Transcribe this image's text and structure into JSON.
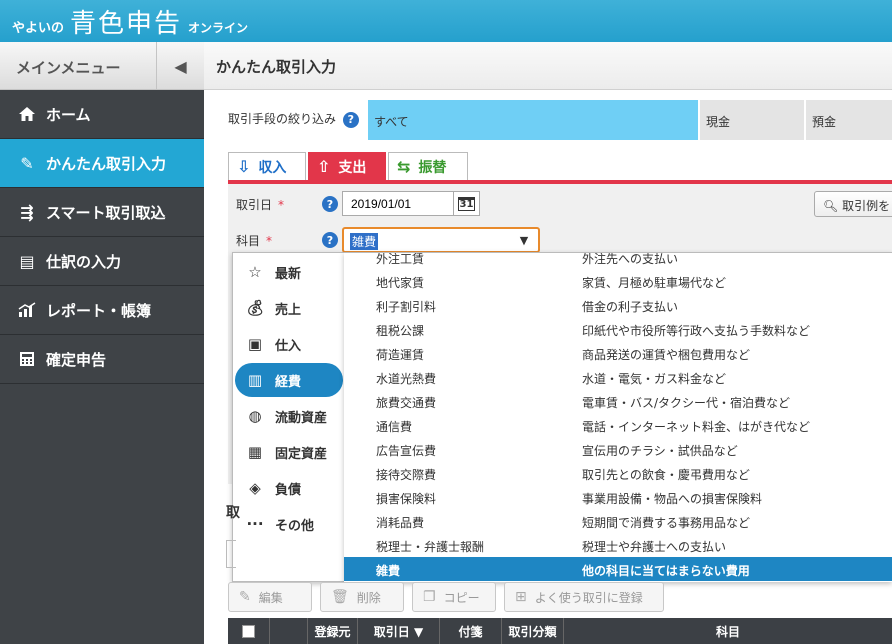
{
  "header": {
    "logo_pre": "やよいの",
    "logo_main": "青色申告",
    "logo_post": "オンライン"
  },
  "sidebar": {
    "title": "メインメニュー",
    "items": [
      {
        "label": "ホーム",
        "icon": "home-icon"
      },
      {
        "label": "かんたん取引入力",
        "icon": "pencil-icon",
        "active": true
      },
      {
        "label": "スマート取引取込",
        "icon": "import-icon"
      },
      {
        "label": "仕訳の入力",
        "icon": "journal-icon"
      },
      {
        "label": "レポート・帳簿",
        "icon": "report-icon"
      },
      {
        "label": "確定申告",
        "icon": "calculator-icon"
      }
    ]
  },
  "page": {
    "title": "かんたん取引入力"
  },
  "filter": {
    "label": "取引手段の絞り込み",
    "options": [
      "すべて",
      "現金",
      "預金"
    ],
    "selected": "すべて"
  },
  "tabs": [
    {
      "label": "収入",
      "icon": "income-icon"
    },
    {
      "label": "支出",
      "icon": "expense-icon",
      "active": true
    },
    {
      "label": "振替",
      "icon": "transfer-icon"
    }
  ],
  "form": {
    "date_label": "取引日",
    "date_value": "2019/01/01",
    "calendar_day": "31",
    "required_mark": "*",
    "search_label": "取引例を",
    "account_label": "科目",
    "account_value": "雑費"
  },
  "categories": [
    {
      "label": "最新",
      "icon": "star-icon"
    },
    {
      "label": "売上",
      "icon": "money-bag-icon"
    },
    {
      "label": "仕入",
      "icon": "box-icon"
    },
    {
      "label": "経費",
      "icon": "receipt-icon",
      "active": true
    },
    {
      "label": "流動資産",
      "icon": "coins-icon"
    },
    {
      "label": "固定資産",
      "icon": "building-icon"
    },
    {
      "label": "負債",
      "icon": "debt-icon"
    },
    {
      "label": "その他",
      "icon": "more-icon"
    }
  ],
  "accounts": [
    {
      "name": "外注工賃",
      "desc": "外注先への支払い"
    },
    {
      "name": "地代家賃",
      "desc": "家賃、月極め駐車場代など"
    },
    {
      "name": "利子割引料",
      "desc": "借金の利子支払い"
    },
    {
      "name": "租税公課",
      "desc": "印紙代や市役所等行政へ支払う手数料など"
    },
    {
      "name": "荷造運賃",
      "desc": "商品発送の運賃や梱包費用など"
    },
    {
      "name": "水道光熱費",
      "desc": "水道・電気・ガス料金など"
    },
    {
      "name": "旅費交通費",
      "desc": "電車賃・バス/タクシー代・宿泊費など"
    },
    {
      "name": "通信費",
      "desc": "電話・インターネット料金、はがき代など"
    },
    {
      "name": "広告宣伝費",
      "desc": "宣伝用のチラシ・試供品など"
    },
    {
      "name": "接待交際費",
      "desc": "取引先との飲食・慶弔費用など"
    },
    {
      "name": "損害保険料",
      "desc": "事業用設備・物品への損害保険料"
    },
    {
      "name": "消耗品費",
      "desc": "短期間で消費する事務用品など"
    },
    {
      "name": "税理士・弁護士報酬",
      "desc": "税理士や弁護士への支払い"
    },
    {
      "name": "雑費",
      "desc": "他の科目に当てはまらない費用",
      "active": true
    }
  ],
  "below": {
    "section_partial": "取",
    "actions": [
      {
        "label": "編集",
        "icon": "pencil-icon"
      },
      {
        "label": "削除",
        "icon": "trash-icon"
      },
      {
        "label": "コピー",
        "icon": "copy-icon"
      },
      {
        "label": "よく使う取引に登録",
        "icon": "bookmark-add-icon"
      }
    ]
  },
  "table": {
    "columns": [
      "登録元",
      "取引日 ▼",
      "付箋",
      "取引分類",
      "科目"
    ]
  }
}
